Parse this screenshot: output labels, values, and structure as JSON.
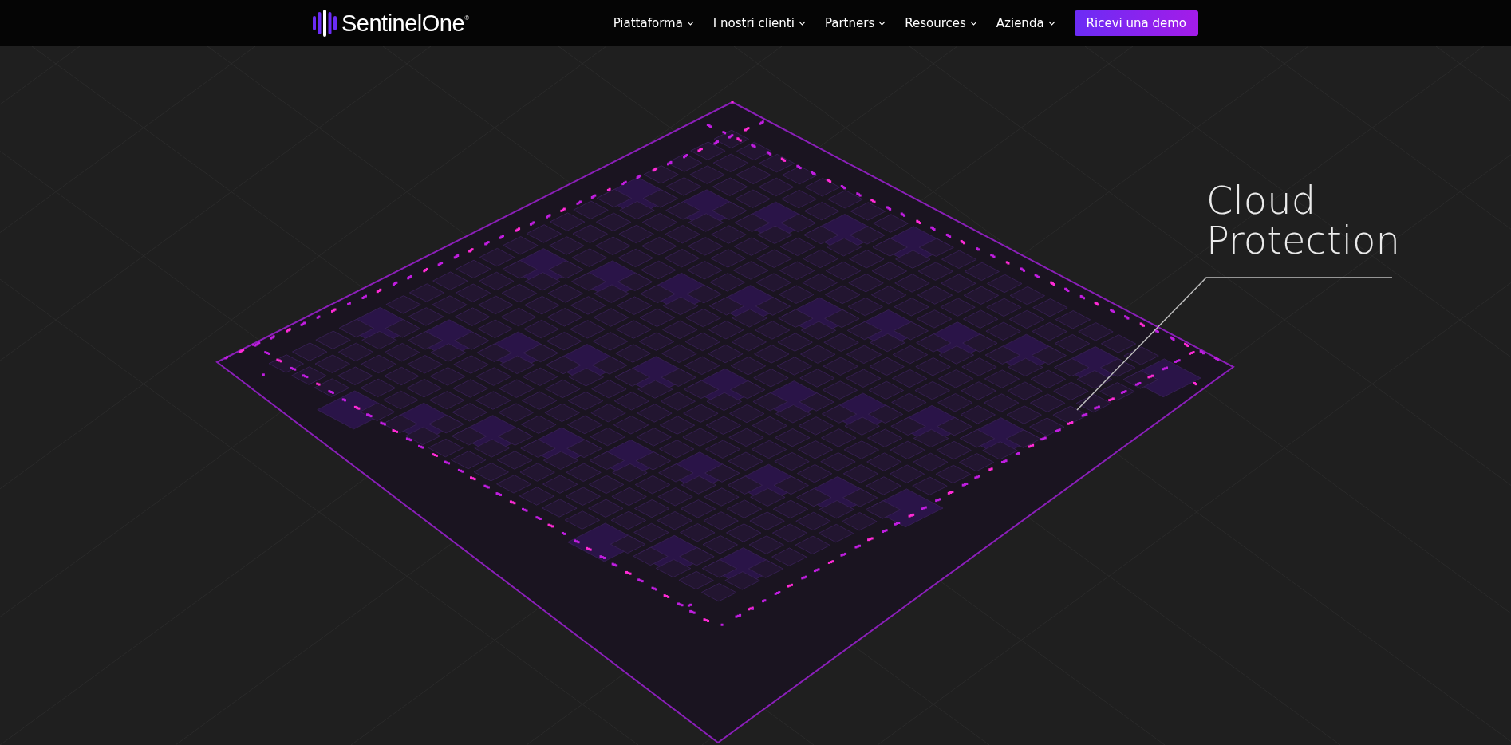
{
  "header": {
    "brand": "SentinelOne$^{®}$",
    "nav": [
      {
        "label": "Piattaforma"
      },
      {
        "label": "I nostri clienti"
      },
      {
        "label": "Partners"
      },
      {
        "label": "Resources"
      },
      {
        "label": "Azienda"
      }
    ],
    "cta": "Ricevi una demo"
  },
  "hero": {
    "caption": [
      "Cloud",
      "Protection"
    ]
  }
}
